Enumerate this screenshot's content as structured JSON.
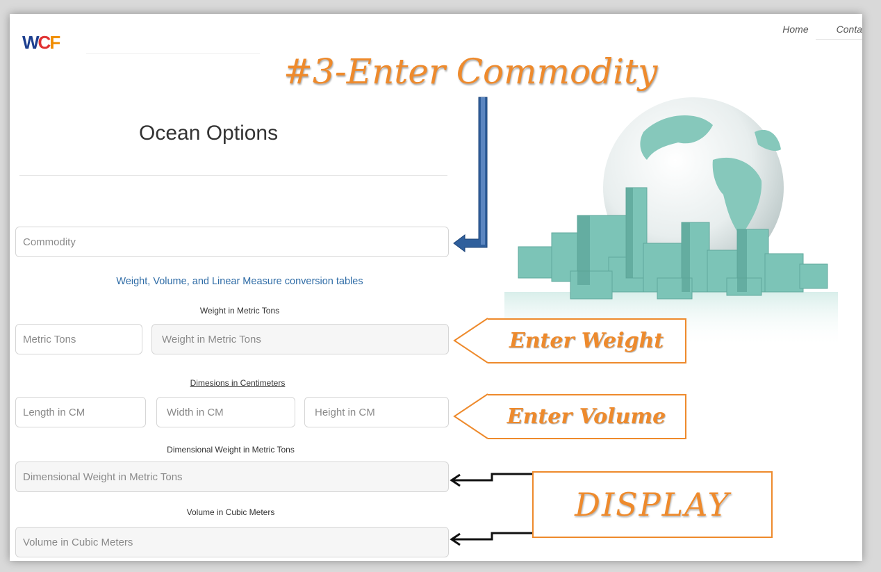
{
  "header": {
    "logo": {
      "w": "W",
      "c": "C",
      "f": "F"
    },
    "nav": [
      "Home",
      "Conta"
    ]
  },
  "callouts": {
    "title": "#3-Enter Commodity",
    "weight": "Enter Weight",
    "volume": "Enter Volume",
    "display": "DISPLAY"
  },
  "form": {
    "heading": "Ocean Options",
    "commodity_placeholder": "Commodity",
    "conversion_link": "Weight, Volume, and Linear Measure conversion tables",
    "weight_label": "Weight in Metric Tons",
    "weight_unit": "Metric Tons",
    "weight_placeholder": "Weight in Metric Tons",
    "dimensions_label": "Dimesions in Centimeters",
    "length_placeholder": "Length in CM",
    "width_placeholder": "Width in CM",
    "height_placeholder": "Height in CM",
    "dim_weight_label": "Dimensional Weight in Metric Tons",
    "dim_weight_placeholder": "Dimensional Weight in Metric Tons",
    "volume_label": "Volume in Cubic Meters",
    "volume_placeholder": "Volume in Cubic Meters"
  },
  "colors": {
    "accent": "#ee8a2c",
    "arrow_blue": "#2f5f9c",
    "link": "#2f6ca6",
    "globe_boxes": "#7cc4b7"
  }
}
